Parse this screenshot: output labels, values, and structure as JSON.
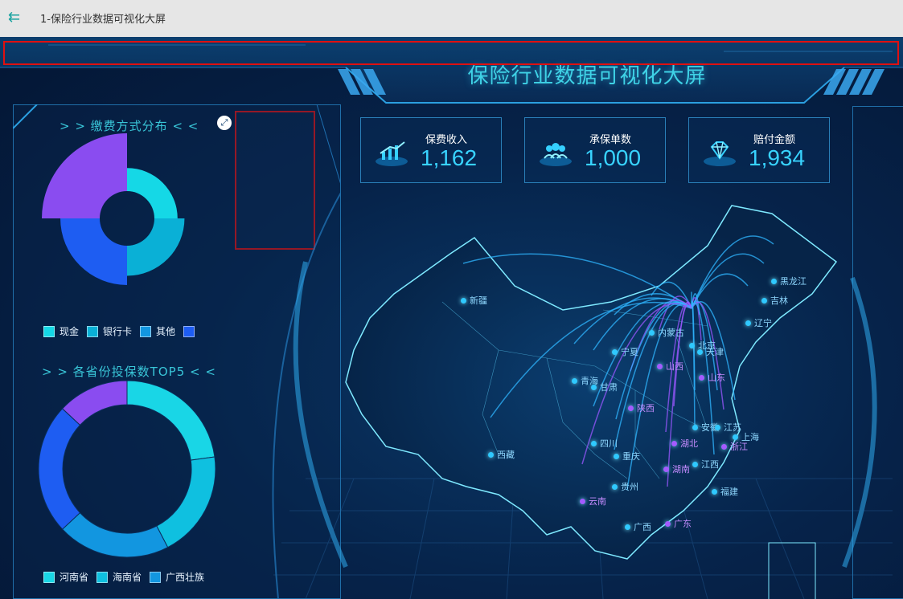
{
  "app": {
    "tab_title": "1-保险行业数据可视化大屏",
    "back_icon": "back-arrow-icon"
  },
  "dashboard": {
    "title": "保险行业数据可视化大屏"
  },
  "stats": [
    {
      "label": "保费收入",
      "value": "1,162",
      "icon": "rising-chart-icon"
    },
    {
      "label": "承保单数",
      "value": "1,000",
      "icon": "users-group-icon"
    },
    {
      "label": "赔付金额",
      "value": "1,934",
      "icon": "diamond-icon"
    }
  ],
  "colors": {
    "accent": "#39c6d8",
    "value": "#38d3ff",
    "highlight": "#e01010",
    "purple": "#8a4cf0",
    "blue": "#1a5cf0",
    "cyan": "#18d2e0",
    "teal": "#12b6d8"
  },
  "chart_data": [
    {
      "type": "pie",
      "title": "> > 缴费方式分布 < <",
      "variant": "rose",
      "categories": [
        "现金",
        "银行卡",
        "其他",
        ""
      ],
      "values": [
        40,
        52,
        68,
        100
      ],
      "colors": [
        "#15d8e6",
        "#0ab0d6",
        "#1e5df2",
        "#8a4cf0"
      ],
      "legend": [
        "现金",
        "银行卡",
        "其他",
        ""
      ]
    },
    {
      "type": "pie",
      "title": "> > 各省份投保数TOP5 < <",
      "variant": "donut",
      "categories": [
        "河南省",
        "海南省",
        "广西壮族",
        "",
        ""
      ],
      "values": [
        21,
        18,
        19,
        22,
        12
      ],
      "colors": [
        "#19d6e6",
        "#0fc0e0",
        "#1296e0",
        "#1e5df2",
        "#8a4cf0"
      ],
      "legend": [
        "河南省",
        "海南省",
        "广西壮族"
      ]
    }
  ],
  "map": {
    "labels": [
      {
        "text": "黑龙江",
        "tone": "blue"
      },
      {
        "text": "吉林",
        "tone": "blue"
      },
      {
        "text": "辽宁",
        "tone": "blue"
      },
      {
        "text": "新疆",
        "tone": "blue"
      },
      {
        "text": "内蒙古",
        "tone": "blue"
      },
      {
        "text": "北京",
        "tone": "blue"
      },
      {
        "text": "天津",
        "tone": "blue"
      },
      {
        "text": "宁夏",
        "tone": "blue"
      },
      {
        "text": "山西",
        "tone": "purple"
      },
      {
        "text": "山东",
        "tone": "purple"
      },
      {
        "text": "青海",
        "tone": "blue"
      },
      {
        "text": "甘肃",
        "tone": "blue"
      },
      {
        "text": "陕西",
        "tone": "purple"
      },
      {
        "text": "安徽",
        "tone": "blue"
      },
      {
        "text": "江苏",
        "tone": "blue"
      },
      {
        "text": "上海",
        "tone": "blue"
      },
      {
        "text": "西藏",
        "tone": "blue"
      },
      {
        "text": "四川",
        "tone": "blue"
      },
      {
        "text": "湖北",
        "tone": "purple"
      },
      {
        "text": "浙江",
        "tone": "purple"
      },
      {
        "text": "重庆",
        "tone": "blue"
      },
      {
        "text": "湖南",
        "tone": "purple"
      },
      {
        "text": "江西",
        "tone": "blue"
      },
      {
        "text": "贵州",
        "tone": "blue"
      },
      {
        "text": "福建",
        "tone": "blue"
      },
      {
        "text": "云南",
        "tone": "purple"
      },
      {
        "text": "广西",
        "tone": "blue"
      },
      {
        "text": "广东",
        "tone": "purple"
      }
    ]
  }
}
